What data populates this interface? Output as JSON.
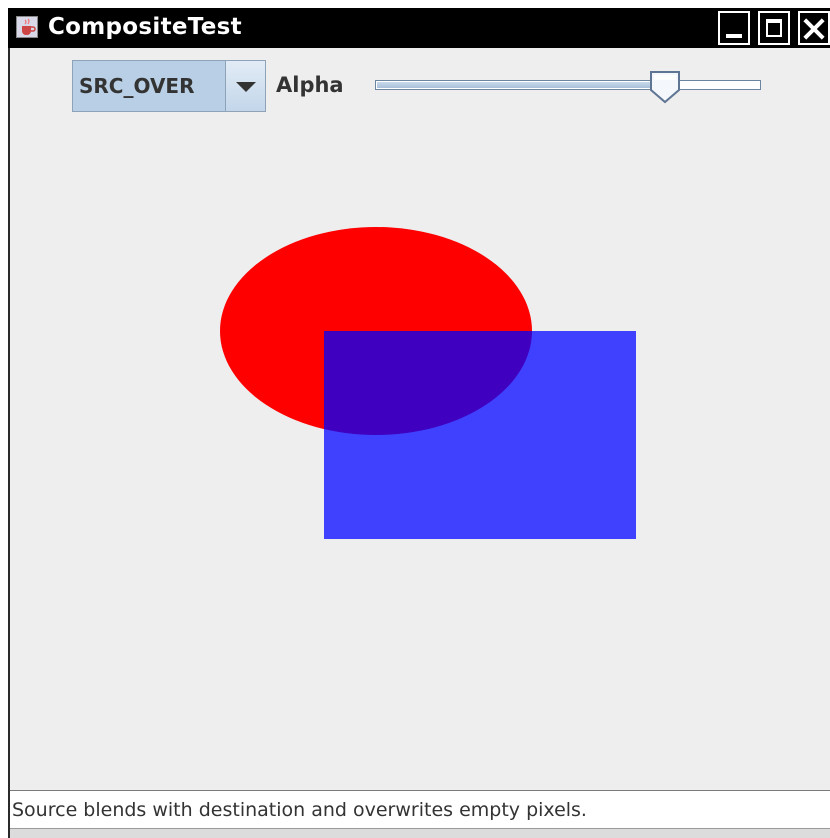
{
  "window": {
    "title": "CompositeTest",
    "icon": "java-cup-icon"
  },
  "toolbar": {
    "composite_rule_selected": "SRC_OVER",
    "alpha_label": "Alpha",
    "alpha_value": 0.75
  },
  "drawing": {
    "ellipse_color": "#ff0000",
    "rectangle_color": "#4040ff",
    "overlap_color": "#3f00bf"
  },
  "status": {
    "message": "Source blends with destination and overwrites empty pixels."
  }
}
